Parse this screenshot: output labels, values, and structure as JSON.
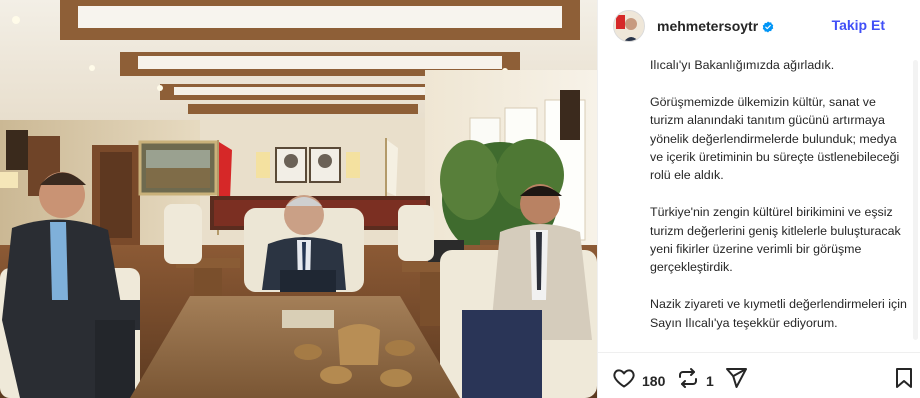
{
  "post": {
    "username": "mehmetersoytr",
    "follow_label": "Takip Et",
    "caption": {
      "p1": "Ilıcalı'yı Bakanlığımızda ağırladık.",
      "p2": "Görüşmemizde ülkemizin kültür, sanat ve turizm alanındaki tanıtım gücünü artırmaya yönelik değerlendirmelerde bulunduk; medya ve içerik üretiminin bu süreçte üstlenebileceği rolü ele aldık.",
      "p3": "Türkiye'nin zengin kültürel birikimini ve eşsiz turizm değerlerini geniş kitlelerle buluşturacak yeni fikirler üzerine verimli bir görüşme gerçekleştirdik.",
      "p4": "Nazik ziyareti ve kıymetli değerlendirmeleri için Sayın Ilıcalı'ya teşekkür ediyorum."
    },
    "likes": "180",
    "reposts": "1"
  },
  "icons": {
    "verified": "verified-badge-icon",
    "like": "heart-icon",
    "repost": "repost-icon",
    "share": "send-icon",
    "save": "bookmark-icon"
  },
  "colors": {
    "accent": "#4150f7",
    "verified": "#0095f6",
    "text": "#262626"
  }
}
